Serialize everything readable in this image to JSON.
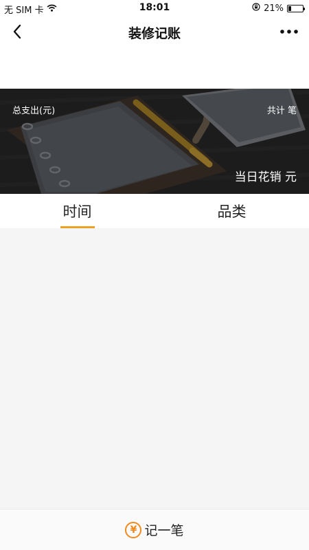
{
  "status_bar": {
    "carrier": "无 SIM 卡",
    "time": "18:01",
    "battery_percent": "21%",
    "battery_level": 0.21
  },
  "nav": {
    "title": "装修记账"
  },
  "banner": {
    "total_label": "总支出(元)",
    "count_text": "共计 笔",
    "daily_text": "当日花销 元"
  },
  "tabs": [
    {
      "label": "时间",
      "active": true
    },
    {
      "label": "品类",
      "active": false
    }
  ],
  "bottom": {
    "yen_symbol": "¥",
    "record_label": "记一笔"
  },
  "colors": {
    "accent": "#f0a020",
    "icon_orange": "#f08a1c",
    "content_bg": "#f5f5f5"
  },
  "icons": {
    "back": "chevron-left-icon",
    "more": "more-dots-icon",
    "wifi": "wifi-icon",
    "lock": "orientation-lock-icon",
    "battery": "battery-icon",
    "yen": "yen-icon"
  }
}
